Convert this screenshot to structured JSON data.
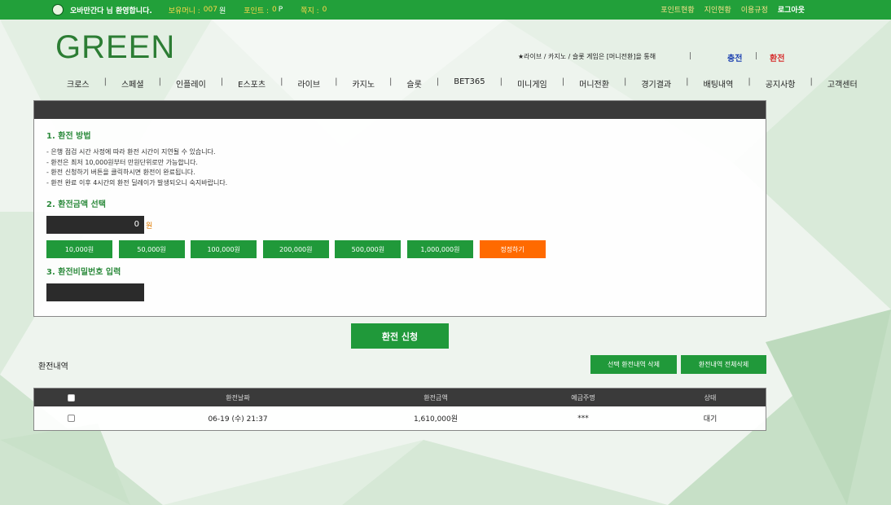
{
  "topbar": {
    "welcome": "오바만간다 님 환영합니다.",
    "money_label": "보유머니 :",
    "money_value": "007",
    "money_unit": "원",
    "point_label": "포인트 :",
    "point_value": "0",
    "point_unit": "P",
    "note_label": "쪽지 :",
    "note_value": "0",
    "links": [
      "포인트현황",
      "지인현황",
      "이용규정"
    ],
    "logout": "로그아웃"
  },
  "header": {
    "logo": "GREEN",
    "notice": "★라이브 / 카지노 / 슬롯 게임은 [머니전환]을 통해",
    "charge": "충전",
    "exchange": "환전",
    "separator": "|"
  },
  "nav": {
    "items": [
      "크로스",
      "스페셜",
      "인플레이",
      "E스포츠",
      "라이브",
      "카지노",
      "슬롯",
      "BET365",
      "미니게임",
      "머니전환",
      "경기결과",
      "배팅내역",
      "공지사항",
      "고객센터"
    ]
  },
  "form": {
    "section1_title": "1. 환전 방법",
    "info_lines": [
      "- 은행 점검 시간 사정에 따라 환전 시간이 지연될 수 있습니다.",
      "- 환전은 최저 10,000원부터 만원단위로만 가능합니다.",
      "- 환전 신청하기 버튼을 클릭하시면 환전이 완료됩니다.",
      "- 환전 완료 이후 4시간의 환전 딜레이가 발생되오니 숙지바랍니다."
    ],
    "section2_title": "2. 환전금액 선택",
    "amount_value": "0",
    "amount_unit": "원",
    "amount_buttons": [
      "10,000원",
      "50,000원",
      "100,000원",
      "200,000원",
      "500,000원",
      "1,000,000원"
    ],
    "reset_button": "정정하기",
    "section3_title": "3. 환전비밀번호 입력",
    "submit": "환전 신청"
  },
  "history": {
    "title": "환전내역",
    "delete_selected": "선택 환전내역 삭제",
    "delete_all": "환전내역 전체삭제",
    "columns": [
      "환전날짜",
      "환전금액",
      "예금주명",
      "상태"
    ],
    "rows": [
      {
        "date": "06-19 (수) 21:37",
        "amount": "1,610,000원",
        "holder": "***",
        "status": "대기"
      }
    ]
  },
  "colors": {
    "brand_green": "#20993a",
    "reset_orange": "#ff6a00",
    "charge_blue": "#1a3fb0",
    "exchange_red": "#d62b2b"
  }
}
